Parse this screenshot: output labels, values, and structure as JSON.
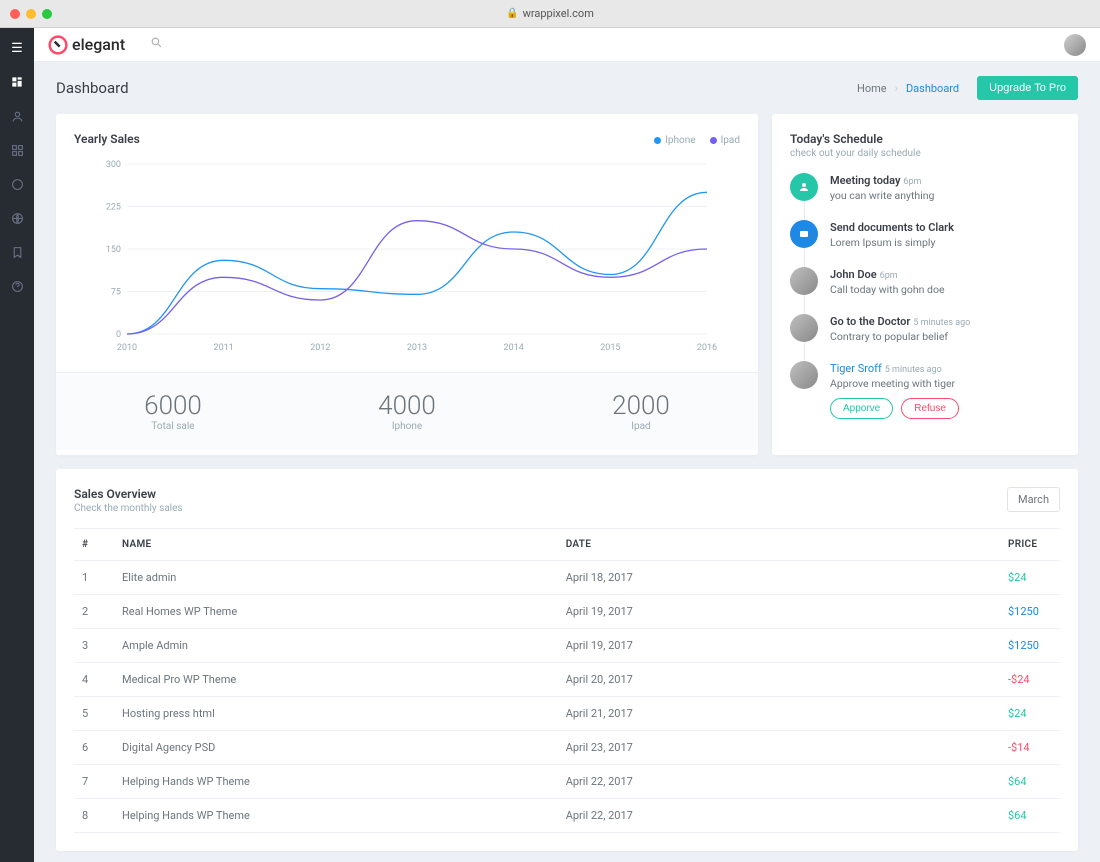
{
  "browser": {
    "url": "wrappixel.com"
  },
  "brand": {
    "name": "elegant"
  },
  "header": {
    "title": "Dashboard",
    "breadcrumb": {
      "home": "Home",
      "current": "Dashboard"
    },
    "upgrade": "Upgrade To Pro"
  },
  "chart_data": {
    "type": "line",
    "title": "Yearly Sales",
    "xlabel": "",
    "ylabel": "",
    "ylim": [
      0,
      300
    ],
    "yticks": [
      0,
      75,
      150,
      225,
      300
    ],
    "x": [
      2010,
      2011,
      2012,
      2013,
      2014,
      2015,
      2016
    ],
    "series": [
      {
        "name": "Iphone",
        "values": [
          0,
          130,
          80,
          70,
          180,
          105,
          250
        ]
      },
      {
        "name": "Ipad",
        "values": [
          0,
          100,
          60,
          200,
          150,
          100,
          150
        ]
      }
    ],
    "summary": [
      {
        "value": "6000",
        "label": "Total sale"
      },
      {
        "value": "4000",
        "label": "Iphone"
      },
      {
        "value": "2000",
        "label": "Ipad"
      }
    ]
  },
  "schedule": {
    "title": "Today's Schedule",
    "subtitle": "check out your daily schedule",
    "items": [
      {
        "title": "Meeting today",
        "time": "6pm",
        "desc": "you can write anything",
        "avatar": "teal",
        "link": false
      },
      {
        "title": "Send documents to Clark",
        "time": "",
        "desc": "Lorem Ipsum is simply",
        "avatar": "blue",
        "link": false
      },
      {
        "title": "John Doe",
        "time": "6pm",
        "desc": "Call today with gohn doe",
        "avatar": "img",
        "link": false
      },
      {
        "title": "Go to the Doctor",
        "time": "5 minutes ago",
        "desc": "Contrary to popular belief",
        "avatar": "img",
        "link": false
      },
      {
        "title": "Tiger Sroff",
        "time": "5 minutes ago",
        "desc": "Approve meeting with tiger",
        "avatar": "img",
        "link": true
      }
    ],
    "actions": {
      "approve": "Apporve",
      "refuse": "Refuse"
    }
  },
  "sales": {
    "title": "Sales Overview",
    "subtitle": "Check the monthly sales",
    "month": "March",
    "cols": {
      "idx": "#",
      "name": "NAME",
      "date": "DATE",
      "price": "PRICE"
    },
    "rows": [
      {
        "idx": "1",
        "name": "Elite admin",
        "date": "April 18, 2017",
        "price": "$24",
        "color": "teal"
      },
      {
        "idx": "2",
        "name": "Real Homes WP Theme",
        "date": "April 19, 2017",
        "price": "$1250",
        "color": "blue"
      },
      {
        "idx": "3",
        "name": "Ample Admin",
        "date": "April 19, 2017",
        "price": "$1250",
        "color": "blue"
      },
      {
        "idx": "4",
        "name": "Medical Pro WP Theme",
        "date": "April 20, 2017",
        "price": "-$24",
        "color": "red"
      },
      {
        "idx": "5",
        "name": "Hosting press html",
        "date": "April 21, 2017",
        "price": "$24",
        "color": "teal"
      },
      {
        "idx": "6",
        "name": "Digital Agency PSD",
        "date": "April 23, 2017",
        "price": "-$14",
        "color": "red"
      },
      {
        "idx": "7",
        "name": "Helping Hands WP Theme",
        "date": "April 22, 2017",
        "price": "$64",
        "color": "teal"
      },
      {
        "idx": "8",
        "name": "Helping Hands WP Theme",
        "date": "April 22, 2017",
        "price": "$64",
        "color": "teal"
      }
    ]
  }
}
